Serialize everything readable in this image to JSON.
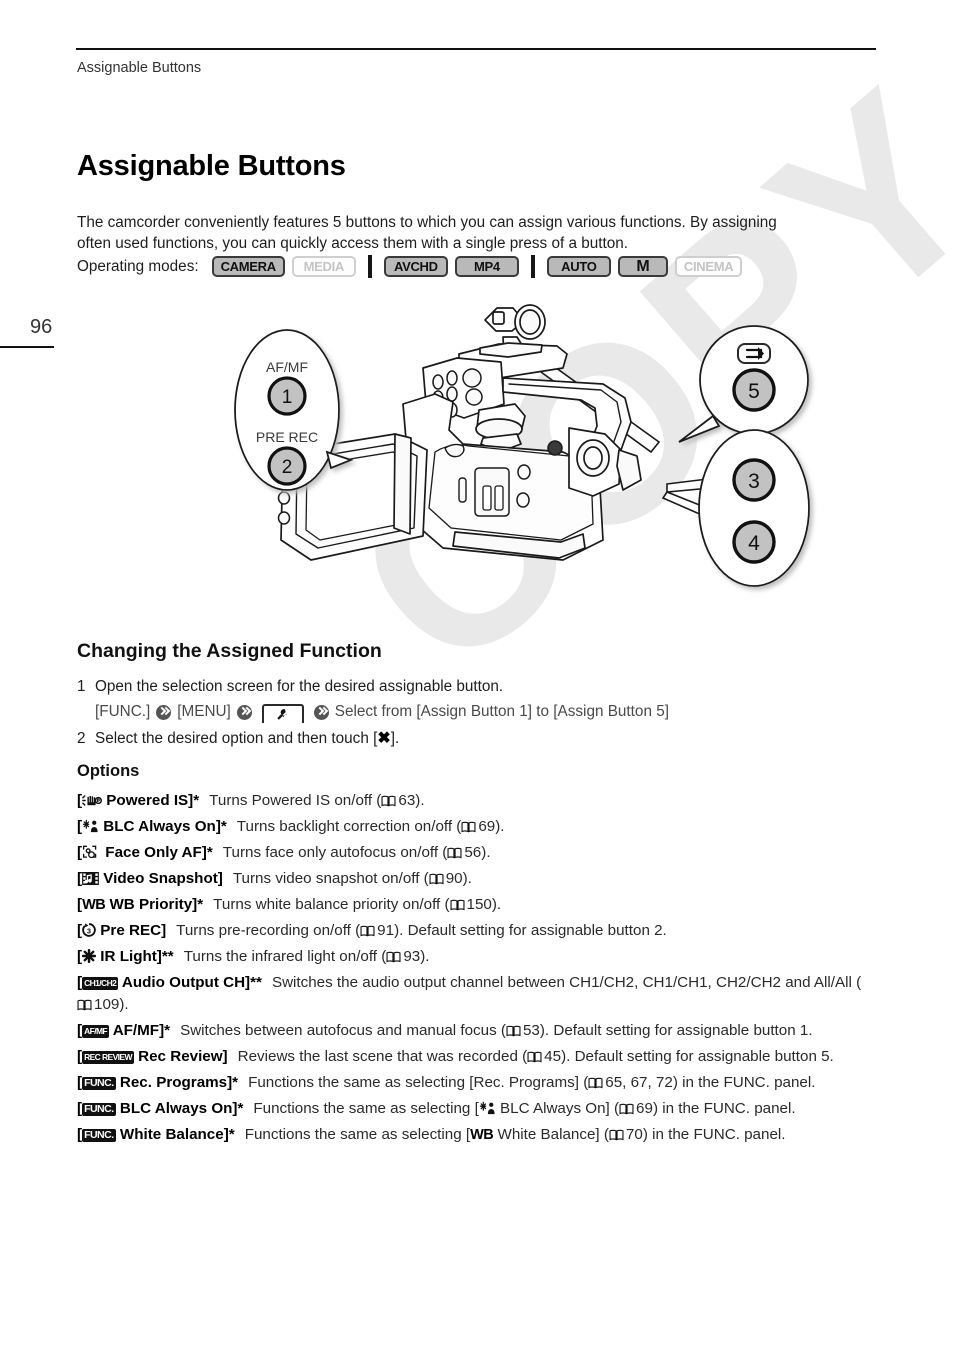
{
  "page": {
    "number": "96",
    "running_head": "Assignable Buttons",
    "watermark": "COPY"
  },
  "header": {
    "title": "Assignable Buttons",
    "intro": "The camcorder conveniently features 5 buttons to which you can assign various functions. By assigning often used functions, you can quickly access them with a single press of a button."
  },
  "operating_modes": {
    "label": "Operating modes:",
    "badges": [
      {
        "text": "CAMERA",
        "active": true
      },
      {
        "text": "MEDIA",
        "active": false
      },
      {
        "text": "AVCHD",
        "active": true
      },
      {
        "text": "MP4",
        "active": true
      },
      {
        "text": "AUTO",
        "active": true
      },
      {
        "text": "M",
        "active": true
      },
      {
        "text": "CINEMA",
        "active": false
      }
    ]
  },
  "diagram": {
    "callouts": [
      {
        "label": "AF/MF",
        "number": "1"
      },
      {
        "label": "PRE REC",
        "number": "2"
      },
      {
        "label": "",
        "number": "3"
      },
      {
        "label": "",
        "number": "4"
      },
      {
        "label": "rec-review-icon",
        "number": "5"
      }
    ]
  },
  "section": {
    "heading": "Changing the Assigned Function",
    "steps": [
      {
        "num": "1",
        "text": "Open the selection screen for the desired assignable button.",
        "path": {
          "first": "[FUNC.]",
          "second": "[MENU]",
          "icon": "wrench-tab-icon",
          "last": "Select from [Assign Button 1] to [Assign Button 5]"
        }
      },
      {
        "num": "2",
        "text_before": "Select the desired option and then touch [",
        "glyph": "✖",
        "text_after": "]."
      }
    ]
  },
  "options": {
    "heading": "Options",
    "items": [
      {
        "icon": "powered-is-icon",
        "name_open": "[",
        "name": "Powered IS]",
        "asterisk": "*",
        "desc_before": "Turns Powered IS on/off (",
        "page": "63",
        "desc_after": ")."
      },
      {
        "icon": "blc-icon",
        "name_open": "[",
        "name": "BLC Always On]",
        "asterisk": "*",
        "desc_before": "Turns backlight correction on/off (",
        "page": "69",
        "desc_after": ")."
      },
      {
        "icon": "face-only-af-icon",
        "name_open": "[",
        "name": "Face Only AF]",
        "asterisk": "*",
        "desc_before": "Turns face only autofocus on/off (",
        "page": "56",
        "desc_after": ")."
      },
      {
        "icon": "video-snapshot-icon",
        "name_open": "[",
        "name": "Video Snapshot]",
        "asterisk": "",
        "desc_before": "Turns video snapshot on/off (",
        "page": "90",
        "desc_after": ")."
      },
      {
        "icon": "wb-icon",
        "name_open": "[",
        "name": "WB Priority]",
        "asterisk": "*",
        "desc_before": "Turns white balance priority on/off (",
        "page": "150",
        "desc_after": ")."
      },
      {
        "icon": "pre-rec-icon",
        "name_open": "[",
        "name": "Pre REC]",
        "asterisk": "",
        "desc_before": "Turns pre-recording on/off (",
        "page": "91",
        "desc_after": "). Default setting for assignable button 2."
      },
      {
        "icon": "ir-light-icon",
        "name_open": "[",
        "name": "IR Light]",
        "asterisk": "**",
        "desc_before": "Turns the infrared light on/off (",
        "page": "93",
        "desc_after": ")."
      },
      {
        "icon": "audio-output-ch-icon",
        "icon_text": "CH1/CH2",
        "name_open": "[",
        "name": "Audio Output CH]",
        "asterisk": "**",
        "desc_before": "Switches the audio output channel between CH1/CH2, CH1/CH1, CH2/CH2 and All/All (",
        "page": "109",
        "desc_after": ")."
      },
      {
        "icon": "af-mf-icon",
        "icon_text": "AF/MF",
        "name_open": "[",
        "name": "AF/MF]",
        "asterisk": "*",
        "desc_before": "Switches between autofocus and manual focus (",
        "page": "53",
        "desc_after": "). Default setting for assignable button 1."
      },
      {
        "icon": "rec-review-icon",
        "icon_text": "REC REVIEW",
        "name_open": "[",
        "name": "Rec Review]",
        "asterisk": "",
        "desc_before": "Reviews the last scene that was recorded  (",
        "page": "45",
        "desc_after": "). Default setting for assignable button 5."
      },
      {
        "icon": "func-icon",
        "icon_text": "FUNC.",
        "name_open": "[",
        "name": "Rec. Programs]",
        "asterisk": "*",
        "desc_before": "Functions the same as selecting [Rec. Programs] (",
        "page": "65, 67, 72",
        "desc_after": ") in the FUNC. panel."
      },
      {
        "icon": "func-icon",
        "icon_text": "FUNC.",
        "name_open": "[",
        "name": "BLC Always On]",
        "asterisk": "*",
        "desc_before": "Functions the same as selecting [",
        "inline_icon": "blc-icon",
        "desc_mid": " BLC Always On] (",
        "page": "69",
        "desc_after": ") in the FUNC. panel."
      },
      {
        "icon": "func-icon",
        "icon_text": "FUNC.",
        "name_open": "[",
        "name": "White Balance]",
        "asterisk": "*",
        "desc_before": "Functions the same as selecting [",
        "inline_icon": "wb-icon",
        "desc_mid": " White Balance] (",
        "page": "70",
        "desc_after": ") in the FUNC. panel."
      }
    ]
  }
}
